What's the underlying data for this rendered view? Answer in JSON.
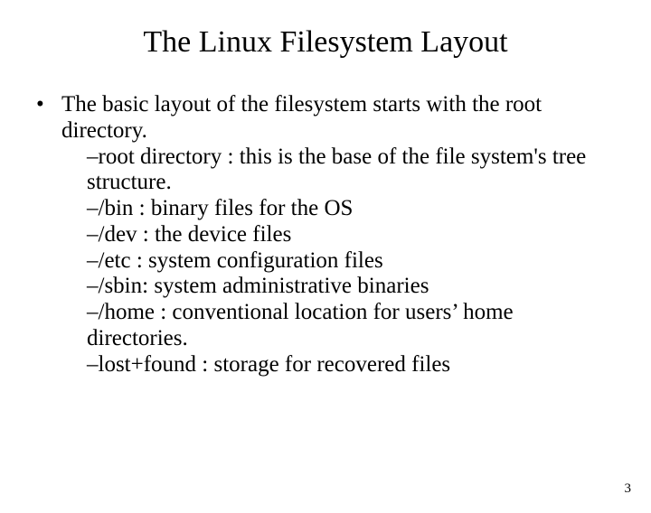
{
  "title": "The Linux Filesystem Layout",
  "bullet_mark": "•",
  "bullet": {
    "lead": "The basic layout of the filesystem starts with the root directory.",
    "subitems": [
      "–root directory : this is the base of the file system's tree structure.",
      "–/bin : binary files for the OS",
      "–/dev : the device files",
      "–/etc : system configuration files",
      "–/sbin: system administrative binaries",
      "–/home : conventional location for users’ home directories.",
      "–lost+found : storage for recovered files"
    ]
  },
  "page_number": "3"
}
